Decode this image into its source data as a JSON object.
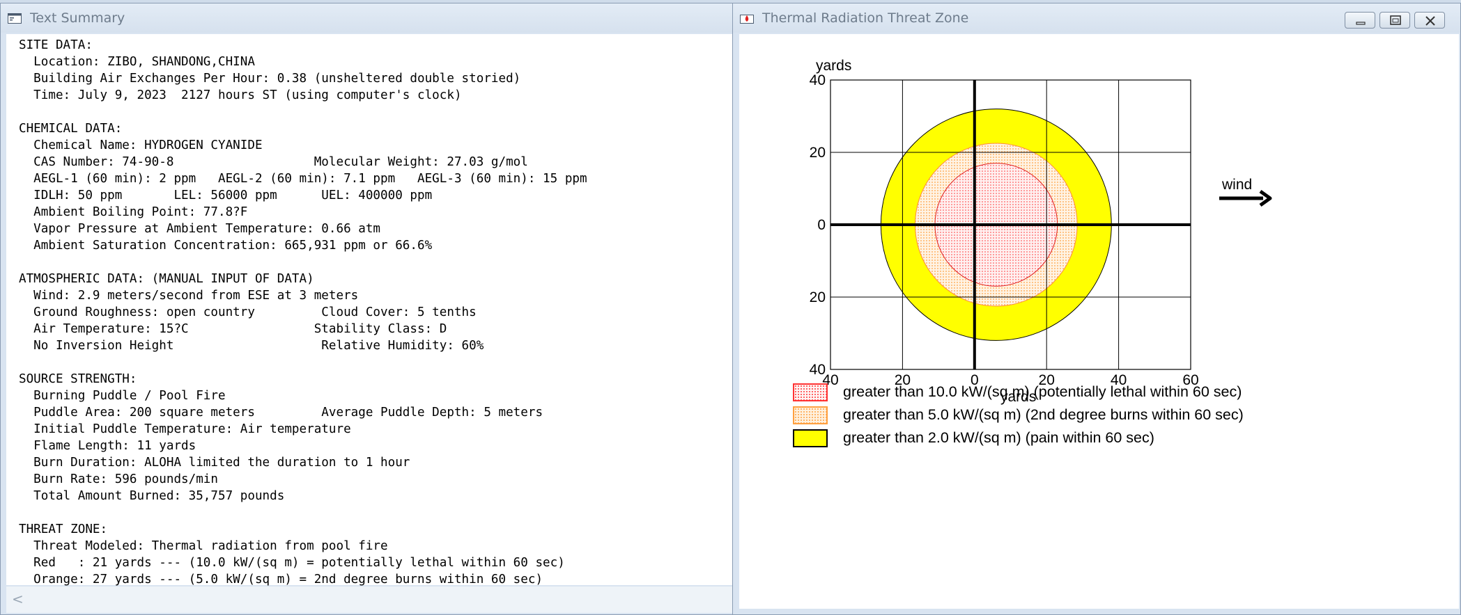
{
  "left_window": {
    "title": "Text Summary",
    "lines": [
      "SITE DATA:",
      "  Location: ZIBO, SHANDONG,CHINA",
      "  Building Air Exchanges Per Hour: 0.38 (unsheltered double storied)",
      "  Time: July 9, 2023  2127 hours ST (using computer's clock)",
      "",
      "CHEMICAL DATA:",
      "  Chemical Name: HYDROGEN CYANIDE",
      "  CAS Number: 74-90-8                   Molecular Weight: 27.03 g/mol",
      "  AEGL-1 (60 min): 2 ppm   AEGL-2 (60 min): 7.1 ppm   AEGL-3 (60 min): 15 ppm",
      "  IDLH: 50 ppm       LEL: 56000 ppm      UEL: 400000 ppm",
      "  Ambient Boiling Point: 77.8?F",
      "  Vapor Pressure at Ambient Temperature: 0.66 atm",
      "  Ambient Saturation Concentration: 665,931 ppm or 66.6%",
      "",
      "ATMOSPHERIC DATA: (MANUAL INPUT OF DATA)",
      "  Wind: 2.9 meters/second from ESE at 3 meters",
      "  Ground Roughness: open country         Cloud Cover: 5 tenths",
      "  Air Temperature: 15?C                 Stability Class: D",
      "  No Inversion Height                    Relative Humidity: 60%",
      "",
      "SOURCE STRENGTH:",
      "  Burning Puddle / Pool Fire",
      "  Puddle Area: 200 square meters         Average Puddle Depth: 5 meters",
      "  Initial Puddle Temperature: Air temperature",
      "  Flame Length: 11 yards",
      "  Burn Duration: ALOHA limited the duration to 1 hour",
      "  Burn Rate: 596 pounds/min",
      "  Total Amount Burned: 35,757 pounds",
      "",
      "THREAT ZONE:",
      "  Threat Modeled: Thermal radiation from pool fire",
      "  Red   : 21 yards --- (10.0 kW/(sq m) = potentially lethal within 60 sec)",
      "  Orange: 27 yards --- (5.0 kW/(sq m) = 2nd degree burns within 60 sec)"
    ],
    "scroll_left_glyph": "<"
  },
  "right_window": {
    "title": "Thermal Radiation Threat Zone",
    "wind_label": "wind",
    "legend": [
      {
        "text": "greater than 10.0 kW/(sq m) (potentially lethal within 60 sec)",
        "color": "#ff3333",
        "pattern": "dots"
      },
      {
        "text": "greater than 5.0 kW/(sq m) (2nd degree burns within 60 sec)",
        "color": "#ffa040",
        "pattern": "dots"
      },
      {
        "text": "greater than 2.0 kW/(sq m) (pain within 60 sec)",
        "color": "#ffff00",
        "pattern": "solid"
      }
    ]
  },
  "chart_data": {
    "type": "area",
    "xlabel": "yards",
    "ylabel": "yards",
    "xlim": [
      -40,
      60
    ],
    "ylim": [
      -40,
      40
    ],
    "x_ticks": [
      -40,
      -20,
      0,
      20,
      40,
      60
    ],
    "x_tick_labels": [
      "40",
      "20",
      "0",
      "20",
      "40",
      "60"
    ],
    "y_ticks": [
      40,
      20,
      0,
      -20,
      -40
    ],
    "y_tick_labels": [
      "40",
      "20",
      "0",
      "20",
      "40"
    ],
    "grid": true,
    "series": [
      {
        "name": "greater than 2.0 kW/(sq m) (pain within 60 sec)",
        "shape": "circle",
        "center": [
          6,
          0
        ],
        "radius": 32,
        "color": "#ffff00"
      },
      {
        "name": "greater than 5.0 kW/(sq m) (2nd degree burns within 60 sec)",
        "shape": "circle",
        "center": [
          6,
          0
        ],
        "radius": 22.5,
        "color": "#ffa040"
      },
      {
        "name": "greater than 10.0 kW/(sq m) (potentially lethal within 60 sec)",
        "shape": "circle",
        "center": [
          6,
          0
        ],
        "radius": 17,
        "color": "#ff3333"
      }
    ],
    "legend_position": "bottom"
  }
}
